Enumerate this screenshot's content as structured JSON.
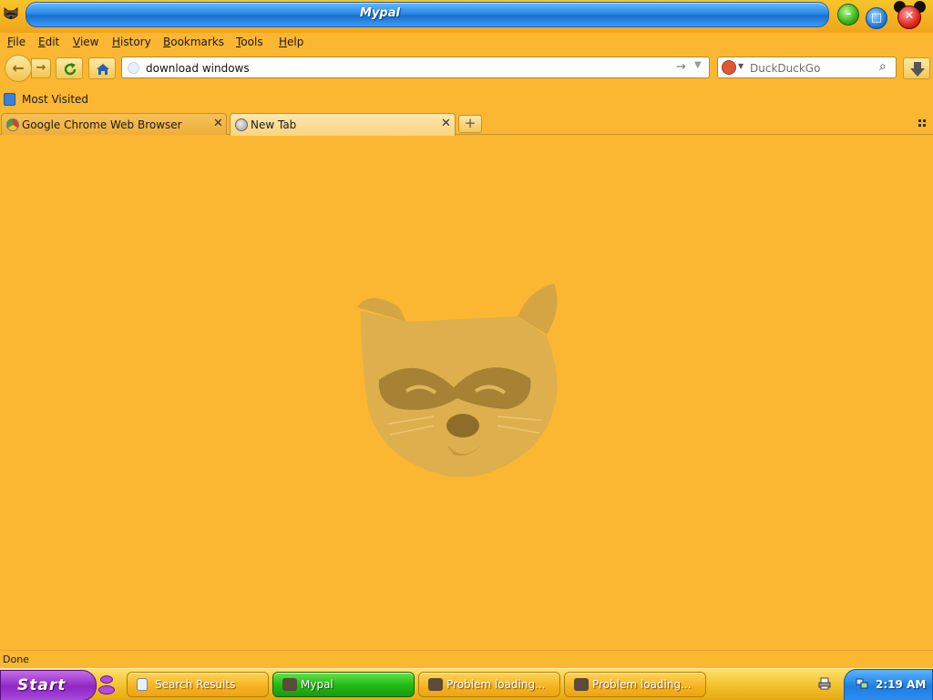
{
  "window": {
    "title": "Mypal",
    "controls": {
      "minimize": "–",
      "maximize": "□",
      "close": "✕"
    }
  },
  "menubar": {
    "items": [
      {
        "label": "File"
      },
      {
        "label": "Edit"
      },
      {
        "label": "View"
      },
      {
        "label": "History"
      },
      {
        "label": "Bookmarks"
      },
      {
        "label": "Tools"
      },
      {
        "label": "Help"
      }
    ]
  },
  "navbar": {
    "url_value": "download windows",
    "search_placeholder": "DuckDuckGo",
    "icons": [
      "back-arrow-icon",
      "forward-arrow-icon",
      "reload-icon",
      "home-icon",
      "globe-icon",
      "go-arrow-icon",
      "dropdown-icon",
      "duckduckgo-icon",
      "magnifier-icon",
      "download-icon"
    ]
  },
  "bookmarks": {
    "items": [
      {
        "label": "Most Visited"
      }
    ]
  },
  "tabs": [
    {
      "label": "Google Chrome Web Browser",
      "active": false,
      "close": "✕"
    },
    {
      "label": "New Tab",
      "active": true,
      "close": "✕"
    }
  ],
  "newtab_label": "+",
  "content": {
    "mascot": "raccoon-face"
  },
  "status": {
    "text": "Done"
  },
  "taskbar": {
    "start_label": "Start",
    "tasks": [
      {
        "label": "Search Results",
        "active": false
      },
      {
        "label": "Mypal",
        "active": true
      },
      {
        "label": "Problem loading...",
        "active": false
      },
      {
        "label": "Problem loading...",
        "active": false
      }
    ],
    "clock": "2:19 AM"
  },
  "colors": {
    "background": "#FBB731",
    "title_blue": "#2a8ae6",
    "active_task_green": "#21b814",
    "start_purple": "#8f26c4",
    "tray_blue": "#1e7fe0"
  }
}
